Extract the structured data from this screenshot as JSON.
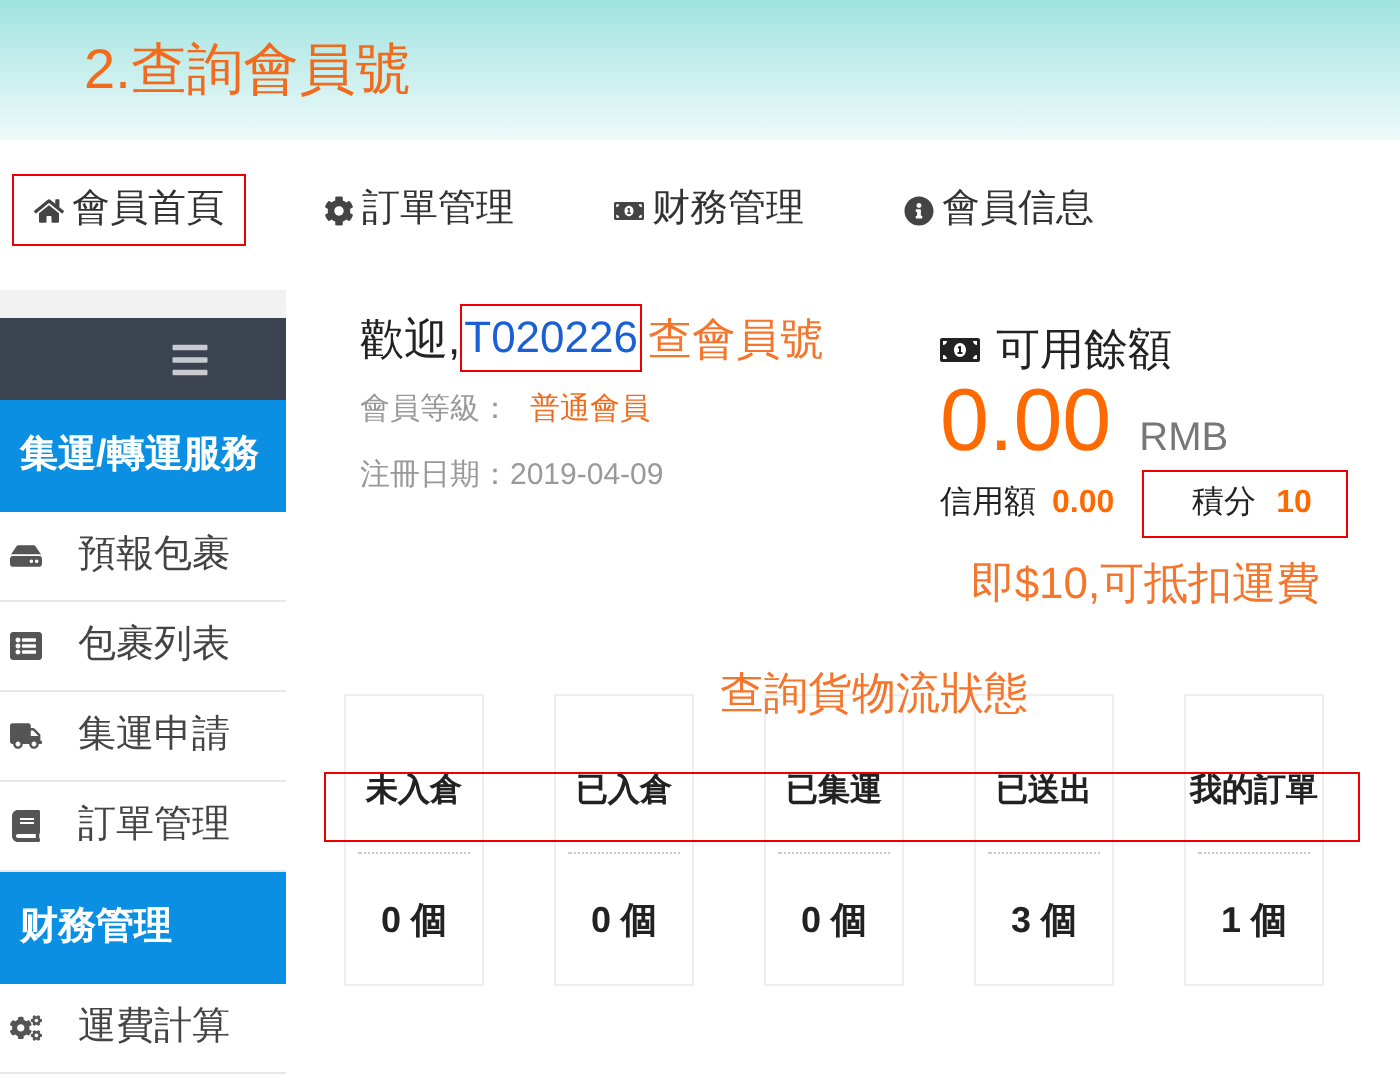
{
  "header": {
    "title": "2.查詢會員號"
  },
  "nav_tabs": [
    {
      "label": "會員首頁",
      "highlighted": true
    },
    {
      "label": "訂單管理",
      "highlighted": false
    },
    {
      "label": "财務管理",
      "highlighted": false
    },
    {
      "label": "會員信息",
      "highlighted": false
    }
  ],
  "sidebar": [
    {
      "kind": "header",
      "label": "集運/轉運服務"
    },
    {
      "kind": "item",
      "label": "預報包裹"
    },
    {
      "kind": "item",
      "label": "包裹列表"
    },
    {
      "kind": "item",
      "label": "集運申請"
    },
    {
      "kind": "item",
      "label": "訂單管理"
    },
    {
      "kind": "header",
      "label": "财務管理"
    },
    {
      "kind": "item",
      "label": "運費計算"
    }
  ],
  "account": {
    "welcome": "歡迎,",
    "member_id": "T020226",
    "member_id_highlighted": true,
    "member_id_note": "查會員號",
    "level_label": "會員等級：",
    "level_value": "普通會員",
    "registered": "注冊日期：2019-04-09"
  },
  "balance": {
    "title": "可用餘額",
    "amount": "0.00",
    "currency": "RMB",
    "credit_label": "信用額",
    "credit_value": "0.00",
    "points_label": "積分",
    "points_value": "10",
    "points_highlighted": true,
    "points_note": "即$10,可抵扣運費"
  },
  "status": {
    "note": "查詢貨物流狀態",
    "row_highlighted": true,
    "cards": [
      {
        "label": "未入倉",
        "count": "0 個"
      },
      {
        "label": "已入倉",
        "count": "0 個"
      },
      {
        "label": "已集運",
        "count": "0 個"
      },
      {
        "label": "已送出",
        "count": "3 個"
      },
      {
        "label": "我的訂單",
        "count": "1 個"
      }
    ]
  }
}
